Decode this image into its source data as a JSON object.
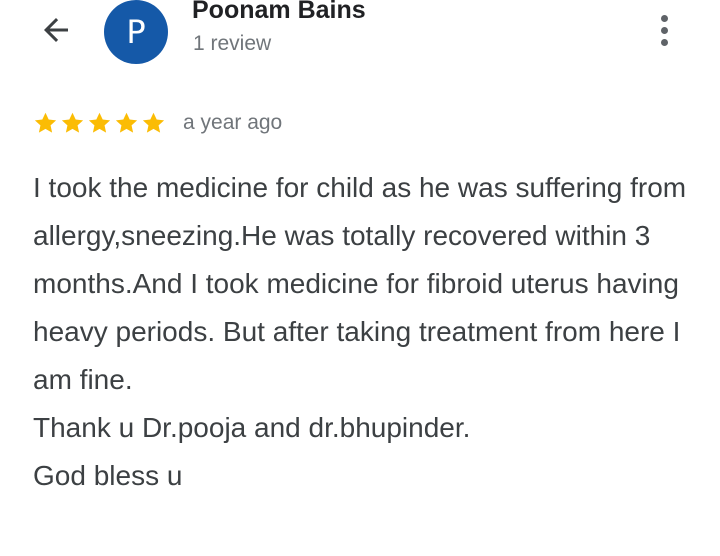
{
  "header": {
    "reviewer_name": "Poonam Bains",
    "review_count": "1 review",
    "avatar_letter": "P",
    "avatar_color": "#1559a8",
    "back_icon": "arrow-back-icon",
    "more_icon": "more-vert-icon"
  },
  "review": {
    "rating": 5,
    "max_rating": 5,
    "star_color": "#fbbc04",
    "time_ago": "a year ago",
    "paragraphs": [
      "I took the medicine for child as he was suffering from allergy,sneezing.He was totally recovered within 3 months.And I took medicine for fibroid uterus having heavy periods. But after taking treatment from here I am fine.",
      "Thank u Dr.pooja and dr.bhupinder.",
      "God bless u"
    ]
  }
}
